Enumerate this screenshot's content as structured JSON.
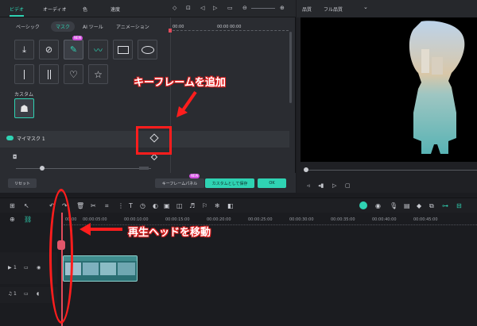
{
  "top_tabs": [
    "ビデオ",
    "オーディオ",
    "色",
    "速度"
  ],
  "sub_tabs": [
    "ベーシック",
    "マスク",
    "AI ツール",
    "アニメーション"
  ],
  "badges": {
    "new": "NEW"
  },
  "ruler_top": {
    "start": "00:00",
    "end": "00:00 00:00"
  },
  "custom_label": "カスタム",
  "mask_row_label": "マイマスク 1",
  "buttons": {
    "reset": "リセット",
    "keyframe_panel": "キーフレームパネル",
    "save_custom": "カスタムとして保存",
    "ok": "OK"
  },
  "preview": {
    "quality_label": "品質",
    "quality_value": "フル品質"
  },
  "timeline_ticks": [
    "00:00",
    "00:00:05:00",
    "00:00:10:00",
    "00:00:15:00",
    "00:00:20:00",
    "00:00:25:00",
    "00:00:30:00",
    "00:00:35:00",
    "00:00:40:00",
    "00:00:45:00"
  ],
  "tracks": [
    {
      "index": "1"
    },
    {
      "index": "1"
    }
  ],
  "annotations": {
    "keyframe": "キーフレームを追加",
    "playhead": "再生ヘッドを移動"
  },
  "colors": {
    "accent": "#2fd3b3",
    "playhead": "#e24b5b",
    "annotation": "#ff1d1d"
  }
}
